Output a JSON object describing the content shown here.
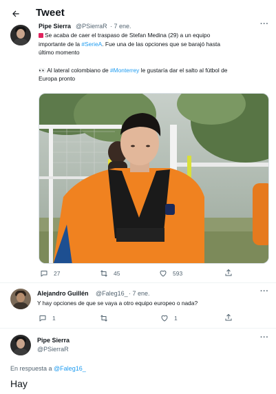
{
  "header": {
    "title": "Tweet",
    "back_icon": "arrow-left-icon"
  },
  "main_tweet": {
    "author_name": "Pipe Sierra",
    "author_handle": "@PSierraR",
    "date": "· 7 ene.",
    "text_line1_pre": "Se acaba de caer el traspaso de Stefan Medina (29) a un equipo",
    "text_line2_pre": "importante de la ",
    "text_line2_tag": "#SerieA",
    "text_line2_post": ". Fue una de las opciones que se barajó hasta",
    "text_line3": "último momento",
    "text_line4_pre": "👀 Al lateral colombiano de ",
    "text_line4_tag": "#Monterrey",
    "text_line4_post": " le gustaría dar el salto al fútbol de",
    "text_line5": "Europa pronto",
    "reply_count": "27",
    "retweet_count": "45",
    "like_count": "593"
  },
  "reply_tweet": {
    "author_name": "Alejandro Guillén",
    "author_handle": "@Faleg16_",
    "date": "· 7 ene.",
    "text": "Y hay opciones de que se vaya a otro equipo europeo o nada?",
    "reply_count": "1",
    "retweet_count": "",
    "like_count": "1"
  },
  "compose": {
    "author_name": "Pipe Sierra",
    "author_handle": "@PSierraR",
    "reply_prefix": "En respuesta a ",
    "reply_target": "@Faleg16_",
    "draft_text": "Hay"
  },
  "colors": {
    "accent": "#1d9bf0",
    "muted": "#536471",
    "text": "#0f1419"
  }
}
